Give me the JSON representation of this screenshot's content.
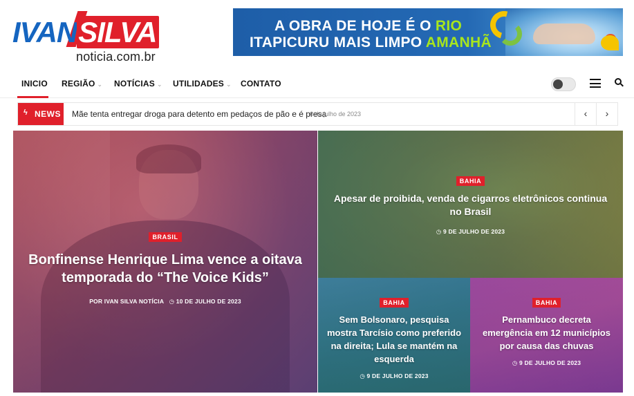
{
  "logo": {
    "part1": "IVAN",
    "part2": "SILVA",
    "tagline": "noticia.com.br"
  },
  "banner": {
    "line1_a": "A OBRA DE HOJE É O ",
    "line1_b": "RIO",
    "line2_a": "ITAPICURU MAIS LIMPO ",
    "line2_b": "AMANHÃ"
  },
  "nav": {
    "items": [
      {
        "label": "INICIO",
        "dropdown": false
      },
      {
        "label": "REGIÃO",
        "dropdown": true
      },
      {
        "label": "NOTÍCIAS",
        "dropdown": true
      },
      {
        "label": "UTILIDADES",
        "dropdown": true
      },
      {
        "label": "CONTATO",
        "dropdown": false
      }
    ],
    "caret": "⌄"
  },
  "ticker": {
    "label": "NEWS",
    "headline": "Mãe tenta entregar droga para detento em pedaços de pão e é presa",
    "date": "6 de julho de 2023",
    "prev": "‹",
    "next": "›"
  },
  "articles": [
    {
      "category": "BRASIL",
      "title": "Bonfinense Henrique Lima vence a oitava temporada do “The Voice Kids”",
      "author_prefix": "POR ",
      "author": "IVAN SILVA NOTÍCIA",
      "date": "10 DE JULHO DE 2023"
    },
    {
      "category": "BAHIA",
      "title": "Apesar de proibida, venda de cigarros eletrônicos continua no Brasil",
      "date": "9 DE JULHO DE 2023"
    },
    {
      "category": "BAHIA",
      "title": "Sem Bolsonaro, pesquisa mostra Tarcísio como preferido na direita; Lula se mantém na esquerda",
      "date": "9 DE JULHO DE 2023"
    },
    {
      "category": "BAHIA",
      "title": "Pernambuco decreta emergência em 12 municípios por causa das chuvas",
      "date": "9 DE JULHO DE 2023"
    }
  ],
  "icons": {
    "clock": "clock-icon",
    "bolt": "bolt-icon",
    "search": "search-icon",
    "menu": "hamburger-menu-icon",
    "theme": "dark-mode-toggle"
  },
  "colors": {
    "accent": "#e0202b",
    "brand_blue": "#1565c0"
  }
}
